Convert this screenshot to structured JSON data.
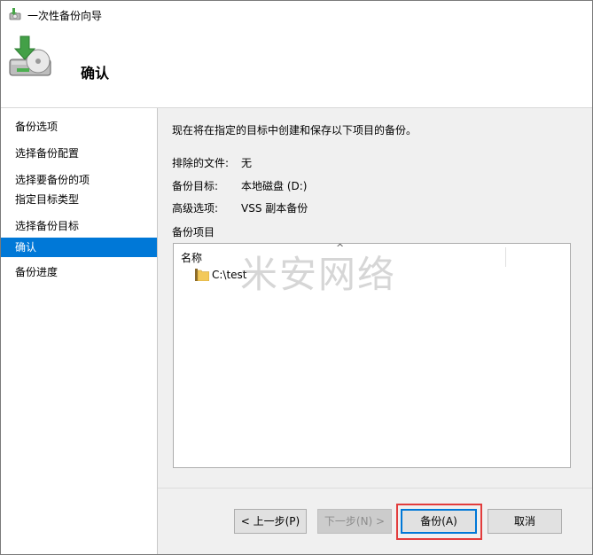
{
  "window": {
    "title": "一次性备份向导"
  },
  "header": {
    "title": "确认"
  },
  "sidebar": {
    "items": [
      {
        "label": "备份选项"
      },
      {
        "label": "选择备份配置"
      },
      {
        "label": "选择要备份的项"
      },
      {
        "label": "指定目标类型"
      },
      {
        "label": "选择备份目标"
      },
      {
        "label": "确认"
      },
      {
        "label": "备份进度"
      }
    ],
    "active_index": 5
  },
  "content": {
    "intro": "现在将在指定的目标中创建和保存以下项目的备份。",
    "excluded_files_label": "排除的文件:",
    "excluded_files_value": "无",
    "target_label": "备份目标:",
    "target_value": "本地磁盘 (D:)",
    "advanced_label": "高级选项:",
    "advanced_value": "VSS 副本备份",
    "items_label": "备份项目",
    "list": {
      "column_name": "名称",
      "items": [
        {
          "name": "C:\\test"
        }
      ]
    }
  },
  "buttons": {
    "back": "< 上一步(P)",
    "next": "下一步(N) >",
    "backup": "备份(A)",
    "cancel": "取消"
  },
  "watermark": "米安网络",
  "colors": {
    "accent": "#0078d7",
    "highlight": "#e23c3c"
  }
}
